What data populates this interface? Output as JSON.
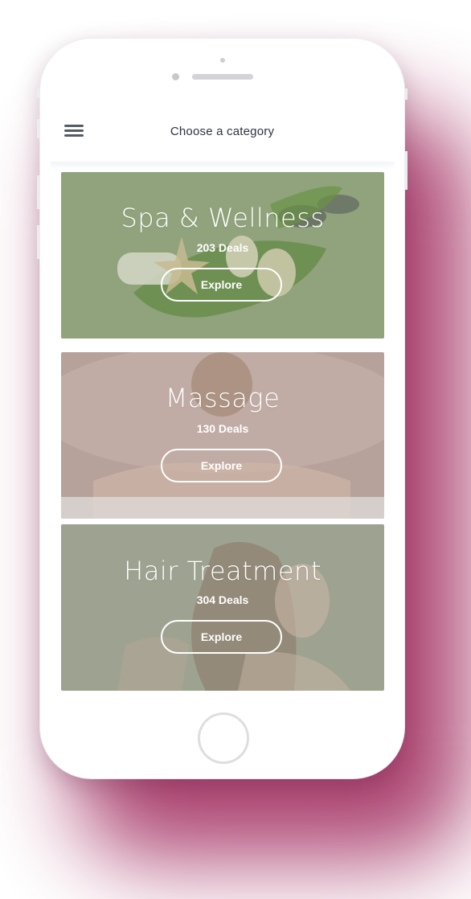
{
  "header": {
    "title": "Choose a category"
  },
  "categories": [
    {
      "title": "Spa & Wellness",
      "deals": "203 Deals",
      "button": "Explore"
    },
    {
      "title": "Massage",
      "deals": "130 Deals",
      "button": "Explore"
    },
    {
      "title": "Hair Treatment",
      "deals": "304 Deals",
      "button": "Explore"
    }
  ],
  "icons": {
    "menu": "hamburger-menu-icon",
    "home": "home-button"
  },
  "colors": {
    "backdrop_glow": "#a83a6a",
    "spa_card": "#8fa27a",
    "massage_card": "#b7a29c",
    "hair_card": "#9da390",
    "header_text": "#2c3344"
  }
}
